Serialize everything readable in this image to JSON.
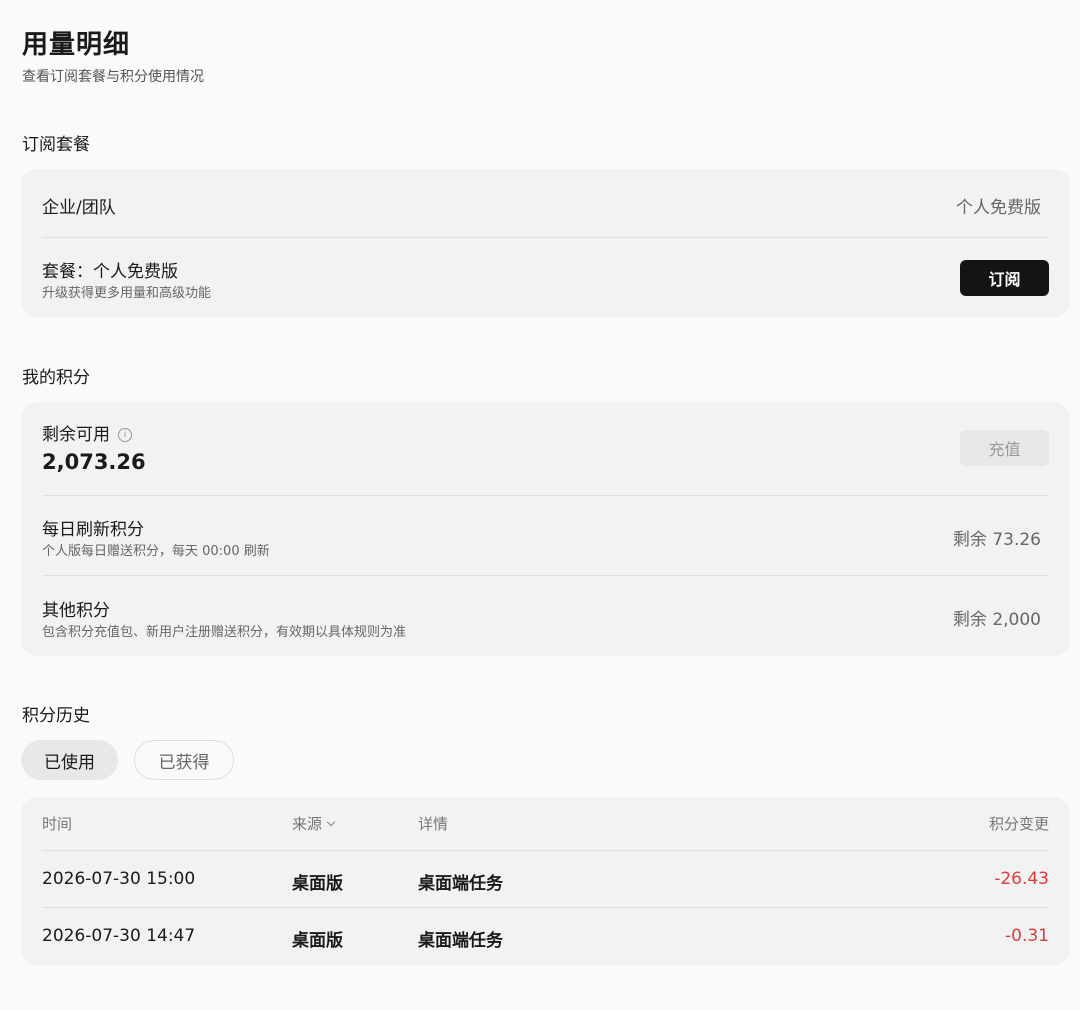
{
  "page": {
    "title": "用量明细",
    "subtitle": "查看订阅套餐与积分使用情况"
  },
  "subscription": {
    "section_title": "订阅套餐",
    "org_label": "企业/团队",
    "org_value": "个人免费版",
    "plan_label": "套餐：个人免费版",
    "plan_sub": "升级获得更多用量和高级功能",
    "subscribe_button": "订阅"
  },
  "credits": {
    "section_title": "我的积分",
    "available_label": "剩余可用",
    "info_icon": "i",
    "available_value": "2,073.26",
    "recharge_button": "充值",
    "daily_label": "每日刷新积分",
    "daily_sub": "个人版每日赠送积分，每天 00:00 刷新",
    "daily_value": "剩余 73.26",
    "other_label": "其他积分",
    "other_sub": "包含积分充值包、新用户注册赠送积分，有效期以具体规则为准",
    "other_value": "剩余 2,000"
  },
  "history": {
    "section_title": "积分历史",
    "tabs": [
      {
        "label": "已使用",
        "active": true
      },
      {
        "label": "已获得",
        "active": false
      }
    ],
    "columns": {
      "time": "时间",
      "source": "来源",
      "detail": "详情",
      "change": "积分变更"
    },
    "rows": [
      {
        "time": "2026-07-30 15:00",
        "source": "桌面版",
        "detail": "桌面端任务",
        "change": "-26.43"
      },
      {
        "time": "2026-07-30 14:47",
        "source": "桌面版",
        "detail": "桌面端任务",
        "change": "-0.31"
      }
    ]
  },
  "colors": {
    "negative": "#e23b3b",
    "primary_button": "#141414",
    "card_bg": "#f2f2f2"
  }
}
